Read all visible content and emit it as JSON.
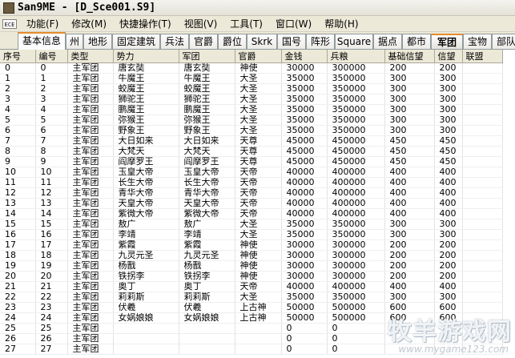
{
  "window": {
    "title": "San9ME - [D_Sce001.S9]"
  },
  "menubar": {
    "icon": "ECE",
    "items": [
      {
        "label": "功能(F)"
      },
      {
        "label": "修改(M)"
      },
      {
        "label": "快捷操作(T)"
      },
      {
        "label": "视图(V)"
      },
      {
        "label": "工具(T)"
      },
      {
        "label": "窗口(W)"
      },
      {
        "label": "帮助(H)"
      }
    ]
  },
  "tabs": [
    {
      "label": "基本信息"
    },
    {
      "label": "州"
    },
    {
      "label": "地形"
    },
    {
      "label": "固定建筑"
    },
    {
      "label": "兵法"
    },
    {
      "label": "官爵"
    },
    {
      "label": "爵位"
    },
    {
      "label": "Skrk"
    },
    {
      "label": "国号"
    },
    {
      "label": "阵形"
    },
    {
      "label": "Square"
    },
    {
      "label": "据点"
    },
    {
      "label": "都市"
    },
    {
      "label": "军团"
    },
    {
      "label": "宝物"
    },
    {
      "label": "部队"
    }
  ],
  "active_tab": "军团",
  "table": {
    "columns": [
      "序号",
      "编号",
      "类型",
      "势力",
      "军团",
      "官爵",
      "金钱",
      "兵粮",
      "基础信望",
      "信望",
      "联盟"
    ],
    "rows": [
      [
        "0",
        "0",
        "主军团",
        "唐玄奘",
        "唐玄奘",
        "神使",
        "30000",
        "300000",
        "200",
        "200",
        ""
      ],
      [
        "1",
        "1",
        "主军团",
        "牛魔王",
        "牛魔王",
        "大圣",
        "35000",
        "350000",
        "300",
        "300",
        ""
      ],
      [
        "2",
        "2",
        "主军团",
        "蛟魔王",
        "蛟魔王",
        "大圣",
        "35000",
        "350000",
        "300",
        "300",
        ""
      ],
      [
        "3",
        "3",
        "主军团",
        "狮驼王",
        "狮驼王",
        "大圣",
        "35000",
        "350000",
        "300",
        "300",
        ""
      ],
      [
        "4",
        "4",
        "主军团",
        "鹏魔王",
        "鹏魔王",
        "大圣",
        "35000",
        "350000",
        "300",
        "300",
        ""
      ],
      [
        "5",
        "5",
        "主军团",
        "弥猴王",
        "弥猴王",
        "大圣",
        "35000",
        "350000",
        "300",
        "300",
        ""
      ],
      [
        "6",
        "6",
        "主军团",
        "野象王",
        "野象王",
        "大圣",
        "35000",
        "350000",
        "300",
        "300",
        ""
      ],
      [
        "7",
        "7",
        "主军团",
        "大日如来",
        "大日如来",
        "天尊",
        "45000",
        "450000",
        "450",
        "450",
        ""
      ],
      [
        "8",
        "8",
        "主军团",
        "大梵天",
        "大梵天",
        "天尊",
        "45000",
        "450000",
        "450",
        "450",
        ""
      ],
      [
        "9",
        "9",
        "主军团",
        "阎摩罗王",
        "阎摩罗王",
        "天尊",
        "45000",
        "450000",
        "450",
        "450",
        ""
      ],
      [
        "10",
        "10",
        "主军团",
        "玉皇大帝",
        "玉皇大帝",
        "天帝",
        "40000",
        "400000",
        "400",
        "400",
        ""
      ],
      [
        "11",
        "11",
        "主军团",
        "长生大帝",
        "长生大帝",
        "天帝",
        "40000",
        "400000",
        "400",
        "400",
        ""
      ],
      [
        "12",
        "12",
        "主军团",
        "青华大帝",
        "青华大帝",
        "天帝",
        "40000",
        "400000",
        "400",
        "400",
        ""
      ],
      [
        "13",
        "13",
        "主军团",
        "天皇大帝",
        "天皇大帝",
        "天帝",
        "40000",
        "400000",
        "400",
        "400",
        ""
      ],
      [
        "14",
        "14",
        "主军团",
        "紫微大帝",
        "紫微大帝",
        "天帝",
        "40000",
        "400000",
        "400",
        "400",
        ""
      ],
      [
        "15",
        "15",
        "主军团",
        "敖广",
        "敖广",
        "大圣",
        "35000",
        "350000",
        "300",
        "300",
        ""
      ],
      [
        "16",
        "16",
        "主军团",
        "李靖",
        "李靖",
        "大圣",
        "35000",
        "350000",
        "300",
        "300",
        ""
      ],
      [
        "17",
        "17",
        "主军团",
        "紫霞",
        "紫霞",
        "神使",
        "30000",
        "300000",
        "200",
        "200",
        ""
      ],
      [
        "18",
        "18",
        "主军团",
        "九灵元圣",
        "九灵元圣",
        "神使",
        "30000",
        "300000",
        "200",
        "200",
        ""
      ],
      [
        "19",
        "19",
        "主军团",
        "杨戬",
        "杨戬",
        "神使",
        "30000",
        "300000",
        "200",
        "200",
        ""
      ],
      [
        "20",
        "20",
        "主军团",
        "铁拐李",
        "铁拐李",
        "神使",
        "30000",
        "300000",
        "200",
        "200",
        ""
      ],
      [
        "21",
        "21",
        "主军团",
        "奥丁",
        "奥丁",
        "天帝",
        "40000",
        "400000",
        "400",
        "400",
        ""
      ],
      [
        "22",
        "22",
        "主军团",
        "莉莉斯",
        "莉莉斯",
        "大圣",
        "35000",
        "350000",
        "300",
        "300",
        ""
      ],
      [
        "23",
        "23",
        "主军团",
        "伏羲",
        "伏羲",
        "上古神",
        "50000",
        "500000",
        "600",
        "600",
        ""
      ],
      [
        "24",
        "24",
        "主军团",
        "女娲娘娘",
        "女娲娘娘",
        "上古神",
        "50000",
        "500000",
        "600",
        "600",
        ""
      ],
      [
        "25",
        "25",
        "主军团",
        "",
        "",
        "",
        "0",
        "0",
        "",
        "",
        ""
      ],
      [
        "26",
        "26",
        "主军团",
        "",
        "",
        "",
        "0",
        "0",
        "",
        "",
        ""
      ],
      [
        "27",
        "27",
        "主军团",
        "",
        "",
        "",
        "0",
        "0",
        "",
        "",
        ""
      ]
    ]
  },
  "watermark": {
    "main": "牧羊游戏网",
    "sub": "www.mygame123.com"
  }
}
